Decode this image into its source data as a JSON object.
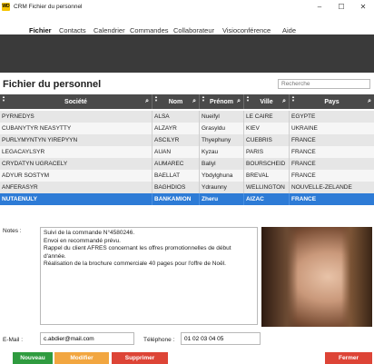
{
  "window": {
    "logo_text": "WD",
    "title": "CRM Fichier du personnel",
    "controls": {
      "minimize": "–",
      "maximize": "☐",
      "close": "✕"
    }
  },
  "menu": {
    "items": [
      {
        "label": "Fichier",
        "active": true
      },
      {
        "label": "Contacts",
        "active": false
      },
      {
        "label": "Calendrier",
        "active": false
      },
      {
        "label": "Commandes",
        "active": false
      },
      {
        "label": "Collaborateur",
        "active": false
      },
      {
        "label": "Visioconférence",
        "active": false
      },
      {
        "label": "Aide",
        "active": false
      }
    ]
  },
  "page": {
    "title": "Fichier du personnel",
    "search_placeholder": "Recherche"
  },
  "table": {
    "columns": [
      "Société",
      "Nom",
      "Prénom",
      "Ville",
      "Pays"
    ],
    "rows": [
      [
        "PYRNEDYS",
        "ALSA",
        "Nueifyl",
        "LE CAIRE",
        "EGYPTE"
      ],
      [
        "CUBANYTYR NEASYTTY",
        "ALZAYR",
        "Grasyldu",
        "KIEV",
        "UKRAINE"
      ],
      [
        "PURLYMYNTYN YIREPYYN",
        "ASCILYR",
        "Thyephuny",
        "CUEBRIS",
        "FRANCE"
      ],
      [
        "LEGACAYLSYR",
        "AUAN",
        "Kyzau",
        "PARIS",
        "FRANCE"
      ],
      [
        "CRYDATYN UGRACELY",
        "AUMAREC",
        "Ballyl",
        "BOURSCHEID",
        "FRANCE"
      ],
      [
        "ADYUR SOSTYM",
        "BAELLAT",
        "Ybdylghuna",
        "BREVAL",
        "FRANCE"
      ],
      [
        "ANFERASYR",
        "BAGHDIOS",
        "Ydraunny",
        "WELLINGTON",
        "NOUVELLE-ZELANDE"
      ],
      [
        "NUTAENULY",
        "BANKAMION",
        "Zheru",
        "AIZAC",
        "FRANCE"
      ]
    ],
    "selected_row": 7
  },
  "form": {
    "notes_label": "Notes :",
    "notes_lines": [
      "Suivi de la commande N°4580246.",
      "Envoi en recommandé prévu.",
      "Rappel du client AFRES concernant les offres promotionnelles de début",
      "d'année.",
      "Réalisation de la brochure commerciale 40 pages pour l'offre de Noël."
    ],
    "email_label": "E-Mail :",
    "email_value": "c.abdier@mail.com",
    "phone_label": "Téléphone :",
    "phone_value": "01 02 03 04 05"
  },
  "buttons": {
    "new": "Nouveau",
    "edit": "Modifier",
    "delete": "Supprimer",
    "close": "Fermer"
  },
  "colors": {
    "banner": "#3a3a3a",
    "header": "#4a4a4a",
    "selected_row": "#2d7bd6",
    "new_button": "#2f9b3f",
    "edit_button": "#f2a640",
    "delete_button": "#dd4436",
    "close_button": "#dd4436"
  },
  "icons": {
    "column_search": "magnifier-icon",
    "sort": "sort-arrows-icon"
  }
}
